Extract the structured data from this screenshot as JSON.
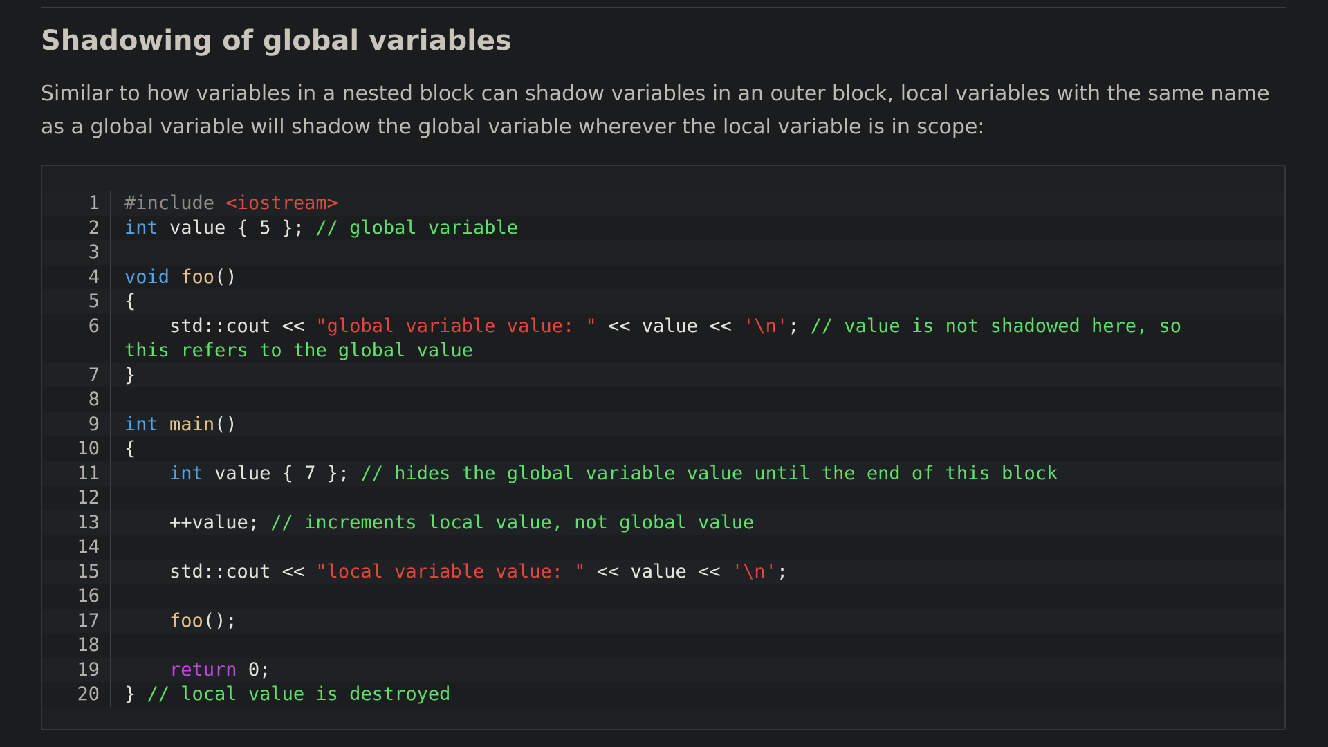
{
  "heading": "Shadowing of global variables",
  "paragraph": "Similar to how variables in a nested block can shadow variables in an outer block, local variables with the same name as a global variable will shadow the global variable wherever the local variable is in scope:",
  "colors": {
    "background": "#1b1c1e",
    "keyword": "#4fa4ea",
    "return_keyword": "#c847e0",
    "function": "#e8c28c",
    "string": "#e5443a",
    "comment": "#5ee06a",
    "preprocessor": "#8f8c87"
  },
  "code": {
    "line_numbers": [
      "1",
      "2",
      "3",
      "4",
      "5",
      "6",
      "",
      "7",
      "8",
      "9",
      "10",
      "11",
      "12",
      "13",
      "14",
      "15",
      "16",
      "17",
      "18",
      "19",
      "20"
    ],
    "l1": {
      "pre": "#include ",
      "inc": "<iostream>"
    },
    "l2": {
      "kw": "int",
      "rest": " value { 5 }; ",
      "cmt": "// global variable"
    },
    "l4": {
      "kw": "void",
      "sp": " ",
      "fn": "foo",
      "rest": "()"
    },
    "l5": {
      "rest": "{"
    },
    "l6": {
      "a": "    std::cout << ",
      "str": "\"global variable value: \"",
      "b": " << value << ",
      "chr": "'\\n'",
      "c": "; ",
      "cmt": "// value is not shadowed here, so"
    },
    "l6b": {
      "cmt": "this refers to the global value"
    },
    "l7": {
      "rest": "}"
    },
    "l9": {
      "kw": "int",
      "sp": " ",
      "fn": "main",
      "rest": "()"
    },
    "l10": {
      "rest": "{"
    },
    "l11": {
      "ind": "    ",
      "kw": "int",
      "rest": " value { 7 }; ",
      "cmt": "// hides the global variable value until the end of this block"
    },
    "l13": {
      "rest": "    ++value; ",
      "cmt": "// increments local value, not global value"
    },
    "l15": {
      "a": "    std::cout << ",
      "str": "\"local variable value: \"",
      "b": " << value << ",
      "chr": "'\\n'",
      "c": ";"
    },
    "l17": {
      "ind": "    ",
      "fn": "foo",
      "rest": "();"
    },
    "l19": {
      "ind": "    ",
      "ret": "return",
      "rest": " 0;"
    },
    "l20": {
      "rest": "} ",
      "cmt": "// local value is destroyed"
    }
  }
}
